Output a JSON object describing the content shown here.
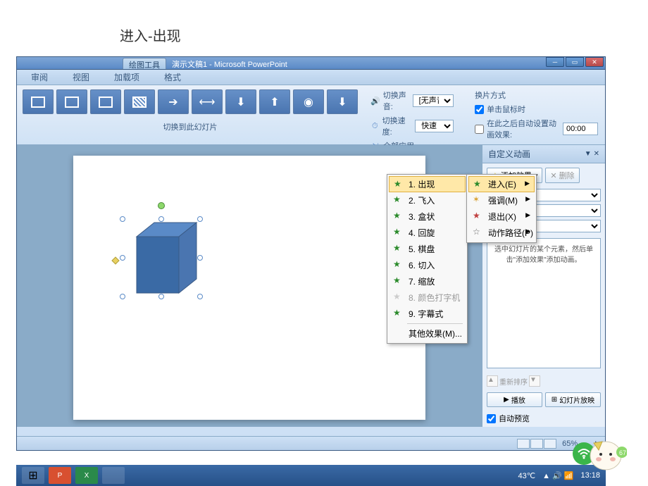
{
  "page_caption": "进入-出现",
  "title_bar": {
    "tool_tab": "绘图工具",
    "document": "演示文稿1 - Microsoft PowerPoint"
  },
  "tabs": {
    "review": "审阅",
    "view": "视图",
    "addins": "加载项",
    "format": "格式"
  },
  "ribbon": {
    "gallery_caption": "切换到此幻灯片",
    "sound_label": "切换声音:",
    "sound_value": "[无声音]",
    "speed_label": "切换速度:",
    "speed_value": "快速",
    "apply_all": "全部应用",
    "advance_header": "换片方式",
    "on_click": "单击鼠标时",
    "auto_after": "在此之后自动设置动画效果:",
    "auto_time": "00:00"
  },
  "anim_pane": {
    "title": "自定义动画",
    "add_effect": "添加效果",
    "remove": "删除",
    "empty_msg": "选中幻灯片的某个元素，然后单击\"添加效果\"添加动画。",
    "reorder": "重新排序",
    "play": "播放",
    "slideshow": "幻灯片放映",
    "auto_preview": "自动预览"
  },
  "effects_menu": {
    "items": [
      {
        "num": "1.",
        "label": "出现"
      },
      {
        "num": "2.",
        "label": "飞入"
      },
      {
        "num": "3.",
        "label": "盒状"
      },
      {
        "num": "4.",
        "label": "回旋"
      },
      {
        "num": "5.",
        "label": "棋盘"
      },
      {
        "num": "6.",
        "label": "切入"
      },
      {
        "num": "7.",
        "label": "缩放"
      },
      {
        "num": "8.",
        "label": "颜色打字机"
      },
      {
        "num": "9.",
        "label": "字幕式"
      }
    ],
    "other": "其他效果(M)..."
  },
  "category_menu": {
    "enter": "进入(E)",
    "emphasis": "强调(M)",
    "exit": "退出(X)",
    "motion": "动作路径(P)"
  },
  "status": {
    "zoom": "65%",
    "temp": "43℃",
    "time": "13:18",
    "notif_count": "67"
  }
}
